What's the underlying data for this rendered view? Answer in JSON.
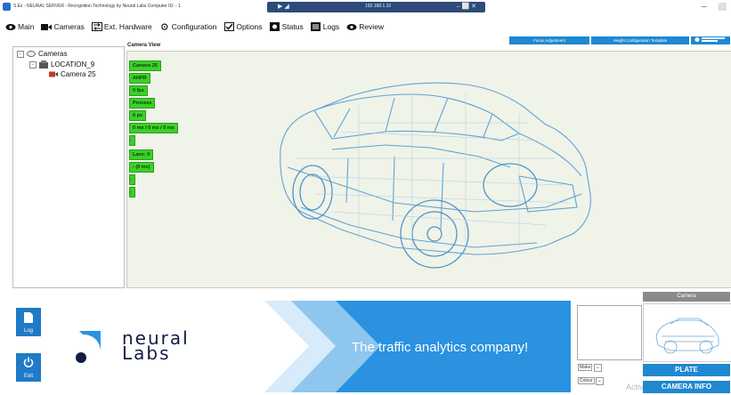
{
  "window": {
    "title": "S.Ex - NEURAL SERVER - Recognition Technology by Neural Labs Computer ID: - 1",
    "media_left": "▶ ◢",
    "media_center": "192.168.1.10",
    "media_right": "– ⬜ ✕"
  },
  "menu": [
    {
      "label": "Main",
      "icon": "eye-icon"
    },
    {
      "label": "Cameras",
      "icon": "video-camera-icon"
    },
    {
      "label": "Ext. Hardware",
      "icon": "swap-icon"
    },
    {
      "label": "Configuration",
      "icon": "gear-icon"
    },
    {
      "label": "Options",
      "icon": "checkbox-icon"
    },
    {
      "label": "Status",
      "icon": "status-icon"
    },
    {
      "label": "Logs",
      "icon": "logs-icon"
    },
    {
      "label": "Review",
      "icon": "eye-icon"
    }
  ],
  "tree": {
    "root": "Cameras",
    "location": "LOCATION_9",
    "camera": "Camera 25"
  },
  "camera_view": {
    "title": "Camera View",
    "buttons": [
      "Focus Adjustment",
      "Height Configuration Template"
    ],
    "tags": [
      "Camera 25",
      "ANPR",
      "0 fps",
      "Process",
      "0 px",
      "0 ms / 0 ms / 0 ms",
      "-",
      "Lane: 0",
      "- (0 ms)",
      "-",
      "-"
    ]
  },
  "sidebar_buttons": {
    "log": "Log",
    "exit": "Exit"
  },
  "banner": {
    "logo_line1": "neural",
    "logo_line2": "Labs",
    "tagline": "The traffic analytics company!"
  },
  "right_panel": {
    "make_label": "Make",
    "colour_label": "Colour",
    "camera_header": "Camera",
    "plate_button": "PLATE",
    "camera_info_button": "CAMERA INFO",
    "watermark": "Activ"
  },
  "colors": {
    "accent": "#1f88d0",
    "tag_green": "#3ccf2a",
    "brand_navy": "#111c44"
  }
}
